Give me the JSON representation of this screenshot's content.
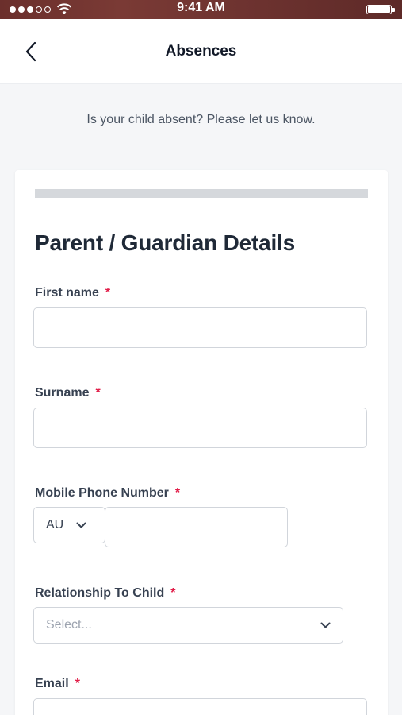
{
  "status_bar": {
    "time": "9:41 AM",
    "signal_icon": "signal-dots-icon",
    "wifi_icon": "wifi-icon",
    "battery_icon": "battery-icon",
    "battery_level": 1.0
  },
  "nav": {
    "back_icon": "chevron-left-icon",
    "title": "Absences"
  },
  "intro": "Is your child absent? Please let us know.",
  "form": {
    "progress": 0.0,
    "section_title": "Parent / Guardian Details",
    "required_marker": "*",
    "fields": {
      "first_name": {
        "label": "First name",
        "value": ""
      },
      "surname": {
        "label": "Surname",
        "value": ""
      },
      "mobile": {
        "label": "Mobile Phone Number",
        "country_code": "AU",
        "value": ""
      },
      "relationship": {
        "label": "Relationship To Child",
        "placeholder": "Select..."
      },
      "email": {
        "label": "Email",
        "value": ""
      }
    }
  },
  "colors": {
    "required": "#e11d48",
    "status_bar": "#6b2f2c",
    "progress_track": "#d5d8dc"
  }
}
